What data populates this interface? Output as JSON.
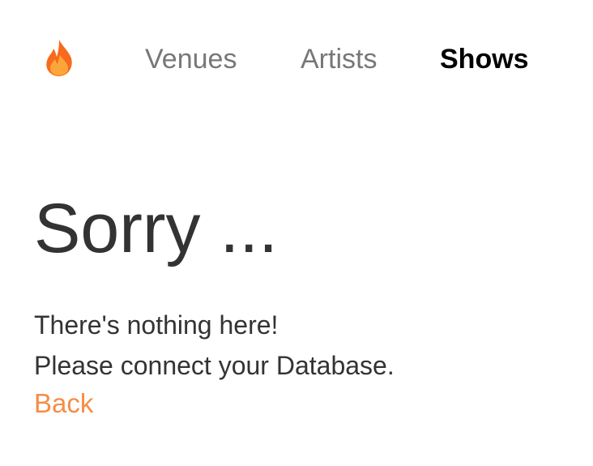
{
  "nav": {
    "logo_icon": "flame-icon",
    "items": [
      {
        "label": "Venues",
        "active": false
      },
      {
        "label": "Artists",
        "active": false
      },
      {
        "label": "Shows",
        "active": true
      }
    ]
  },
  "main": {
    "title": "Sorry ...",
    "message_lines": [
      "There's nothing here!",
      "Please connect your Database."
    ],
    "back_label": "Back"
  },
  "colors": {
    "flame_outer": "#f86a1d",
    "flame_inner": "#fca63a",
    "nav_inactive": "#777777",
    "nav_active": "#000000",
    "text": "#333333",
    "link": "#f58d45"
  }
}
